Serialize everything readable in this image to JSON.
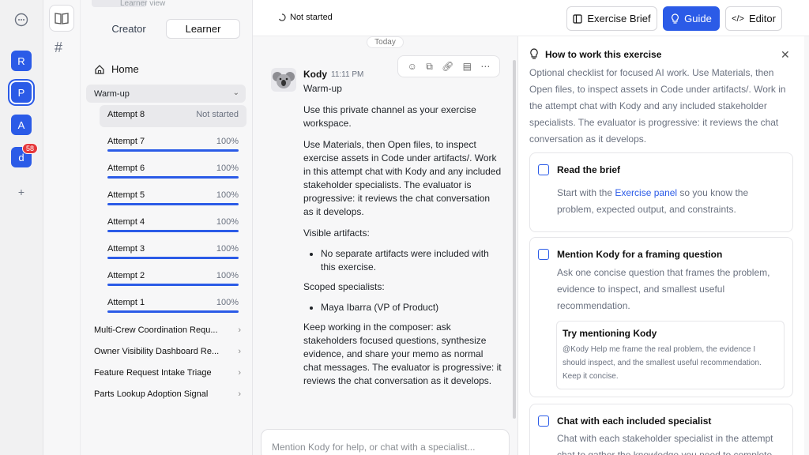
{
  "top_hint": "Learner view",
  "rail": {
    "workspaces": [
      "R",
      "P",
      "A",
      "d"
    ],
    "badge": "58"
  },
  "sidebar": {
    "toggle": {
      "creator": "Creator",
      "learner": "Learner"
    },
    "home": "Home",
    "section": "Warm-up",
    "attempts": [
      {
        "name": "Attempt 8",
        "status": "Not started",
        "progress": 0
      },
      {
        "name": "Attempt 7",
        "status": "100%",
        "progress": 1
      },
      {
        "name": "Attempt 6",
        "status": "100%",
        "progress": 1
      },
      {
        "name": "Attempt 5",
        "status": "100%",
        "progress": 1
      },
      {
        "name": "Attempt 4",
        "status": "100%",
        "progress": 1
      },
      {
        "name": "Attempt 3",
        "status": "100%",
        "progress": 1
      },
      {
        "name": "Attempt 2",
        "status": "100%",
        "progress": 1
      },
      {
        "name": "Attempt 1",
        "status": "100%",
        "progress": 1
      }
    ],
    "groups": [
      "Multi-Crew Coordination Requ...",
      "Owner Visibility Dashboard Re...",
      "Feature Request Intake Triage",
      "Parts Lookup Adoption Signal"
    ]
  },
  "header": {
    "status": "Not started",
    "btn_brief": "Exercise Brief",
    "btn_guide": "Guide",
    "btn_editor": "Editor"
  },
  "chat": {
    "date": "Today",
    "author": "Kody",
    "time": "11:11 PM",
    "p1": "Warm-up",
    "p2": "Use this private channel as your exercise workspace.",
    "p3": "Use Materials, then Open files, to inspect exercise assets in Code under artifacts/. Work in this attempt chat with Kody and any included stakeholder specialists. The evaluator is progressive: it reviews the chat conversation as it develops.",
    "p4": "Visible artifacts:",
    "b1": "No separate artifacts were included with this exercise.",
    "p5": "Scoped specialists:",
    "b2": "Maya Ibarra (VP of Product)",
    "p6": "Keep working in the composer: ask stakeholders focused questions, synthesize evidence, and share your memo as normal chat messages. The evaluator is progressive: it reviews the chat conversation as it develops.",
    "composer_placeholder": "Mention Kody for help, or chat with a specialist..."
  },
  "guide": {
    "title": "How to work this exercise",
    "intro": "Optional checklist for focused AI work. Use Materials, then Open files, to inspect assets in Code under artifacts/. Work in the attempt chat with Kody and any included stakeholder specialists. The evaluator is progressive: it reviews the chat conversation as it develops.",
    "c1_title": "Read the brief",
    "c1_pre": "Start with the ",
    "c1_link": "Exercise panel",
    "c1_post": " so you know the problem, expected output, and constraints.",
    "c2_title": "Mention Kody for a framing question",
    "c2_text": "Ask one concise question that frames the problem, evidence to inspect, and smallest useful recommendation.",
    "try_title": "Try mentioning Kody",
    "try_text": "@Kody Help me frame the real problem, the evidence I should inspect, and the smallest useful recommendation. Keep it concise.",
    "c3_title": "Chat with each included specialist",
    "c3_text": "Chat with each stakeholder specialist in the attempt chat to gather the knowledge you need to complete"
  },
  "colors": {
    "accent": "#2b5be7"
  }
}
